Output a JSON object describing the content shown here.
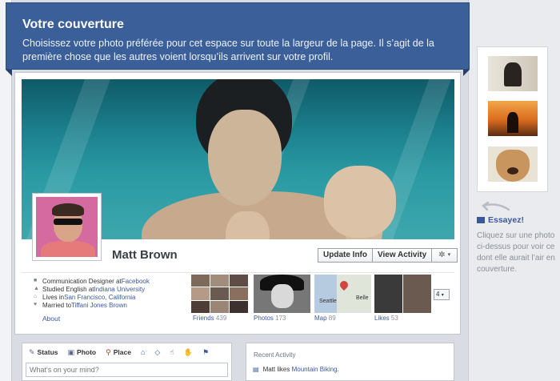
{
  "banner": {
    "title": "Votre couverture",
    "description": "Choisissez votre photo préférée pour cet espace sur toute la largeur de la page. Il s’agit de la première chose que les autres voient lorsqu’ils arrivent sur votre profil."
  },
  "profile": {
    "name": "Matt Brown",
    "actions": {
      "update_info": "Update Info",
      "view_activity": "View Activity",
      "settings_icon": "gear-icon"
    },
    "info": [
      {
        "icon": "briefcase-icon",
        "prefix": "Communication Designer at ",
        "link": "Facebook"
      },
      {
        "icon": "graduation-cap-icon",
        "prefix": "Studied English at ",
        "link": "Indiana University"
      },
      {
        "icon": "home-icon",
        "prefix": "Lives in ",
        "link": "San Francisco, California"
      },
      {
        "icon": "heart-icon",
        "prefix": "Married to ",
        "link": "Tiffani Jones Brown"
      }
    ],
    "about_label": "About",
    "tiles": [
      {
        "label": "Friends",
        "count": "439"
      },
      {
        "label": "Photos",
        "count": "173"
      },
      {
        "label": "Map",
        "count": "89"
      },
      {
        "label": "Likes",
        "count": "53"
      }
    ],
    "map_labels": {
      "seattle": "Seattle",
      "belle": "Belle"
    },
    "more_count": "4"
  },
  "composer": {
    "tabs": [
      {
        "label": "Status",
        "icon": "status-icon"
      },
      {
        "label": "Photo",
        "icon": "photo-icon"
      },
      {
        "label": "Place",
        "icon": "place-icon"
      }
    ],
    "placeholder": "What's on your mind?"
  },
  "activity": {
    "header": "Recent Activity",
    "item_prefix": "Matt likes ",
    "item_link": "Mountain Biking",
    "item_suffix": "."
  },
  "sidebar": {
    "try_label": "Essayez!",
    "tip": "Cliquez sur une photo ci-dessus pour voir ce dont elle aurait l’air en couverture."
  },
  "colors": {
    "brand": "#3b5998",
    "banner": "#3b5f99"
  }
}
